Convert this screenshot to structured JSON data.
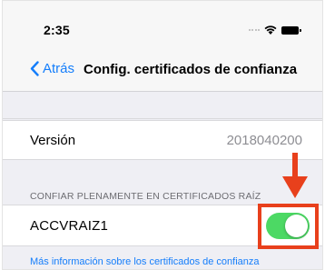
{
  "status_bar": {
    "time": "2:35"
  },
  "nav": {
    "back_label": "Atrás",
    "title": "Config. certificados de confianza"
  },
  "version_row": {
    "label": "Versión",
    "value": "2018040200"
  },
  "trust_section": {
    "header": "CONFIAR PLENAMENTE EN CERTIFICADOS RAÍZ",
    "certificate": {
      "name": "ACCVRAIZ1",
      "enabled": true
    },
    "more_info_link": "Más información sobre los certificados de confianza"
  },
  "colors": {
    "accent": "#157efb",
    "toggle_on": "#4cd964",
    "annotation": "#e8401c",
    "background": "#efeff4"
  },
  "icons": [
    "back-chevron-icon",
    "cellular-signal-icon",
    "wifi-icon",
    "battery-icon",
    "annotation-arrow-icon"
  ]
}
